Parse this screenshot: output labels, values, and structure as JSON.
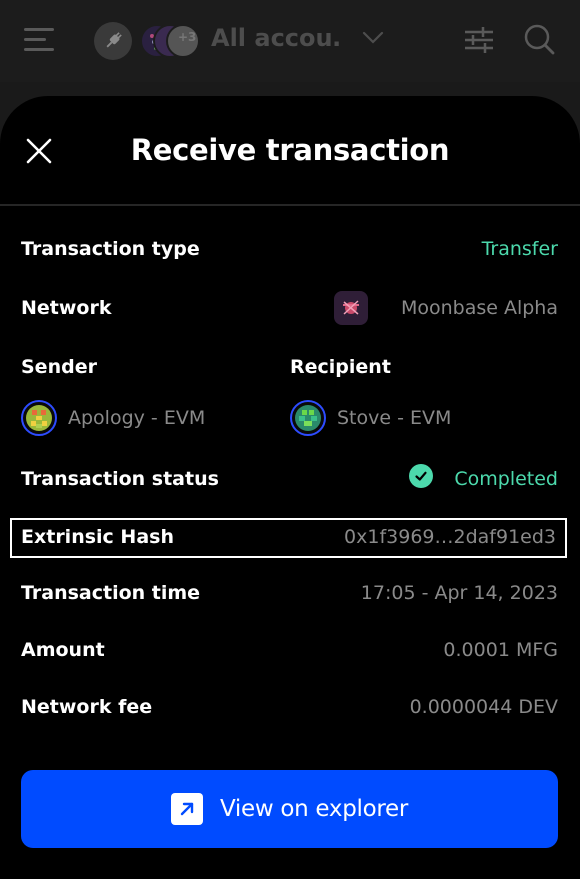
{
  "topbar": {
    "account_label": "All accou…",
    "extra_accounts_count": "+3",
    "icons": [
      "menu-icon",
      "plug-icon",
      "chevron-down-icon",
      "filter-icon",
      "search-icon"
    ]
  },
  "sheet": {
    "title": "Receive transaction",
    "close_icon": "close-icon"
  },
  "details": {
    "transaction_type": {
      "label": "Transaction type",
      "value": "Transfer"
    },
    "network": {
      "label": "Network",
      "value": "Moonbase Alpha"
    },
    "sender": {
      "label": "Sender",
      "name": "Apology - EVM"
    },
    "recipient": {
      "label": "Recipient",
      "name": "Stove - EVM"
    },
    "status": {
      "label": "Transaction status",
      "value": "Completed"
    },
    "extrinsic_hash": {
      "label": "Extrinsic Hash",
      "value": "0x1f3969…2daf91ed3"
    },
    "time": {
      "label": "Transaction time",
      "value": "17:05 - Apr 14, 2023"
    },
    "amount": {
      "label": "Amount",
      "value": "0.0001 MFG"
    },
    "fee": {
      "label": "Network fee",
      "value": "0.0000044 DEV"
    }
  },
  "actions": {
    "explorer_label": "View on explorer",
    "explorer_icon": "external-link-icon"
  },
  "colors": {
    "accent": "#004bff",
    "success": "#4cd9ac",
    "muted_text": "#8a8a8a",
    "background": "#000000"
  }
}
